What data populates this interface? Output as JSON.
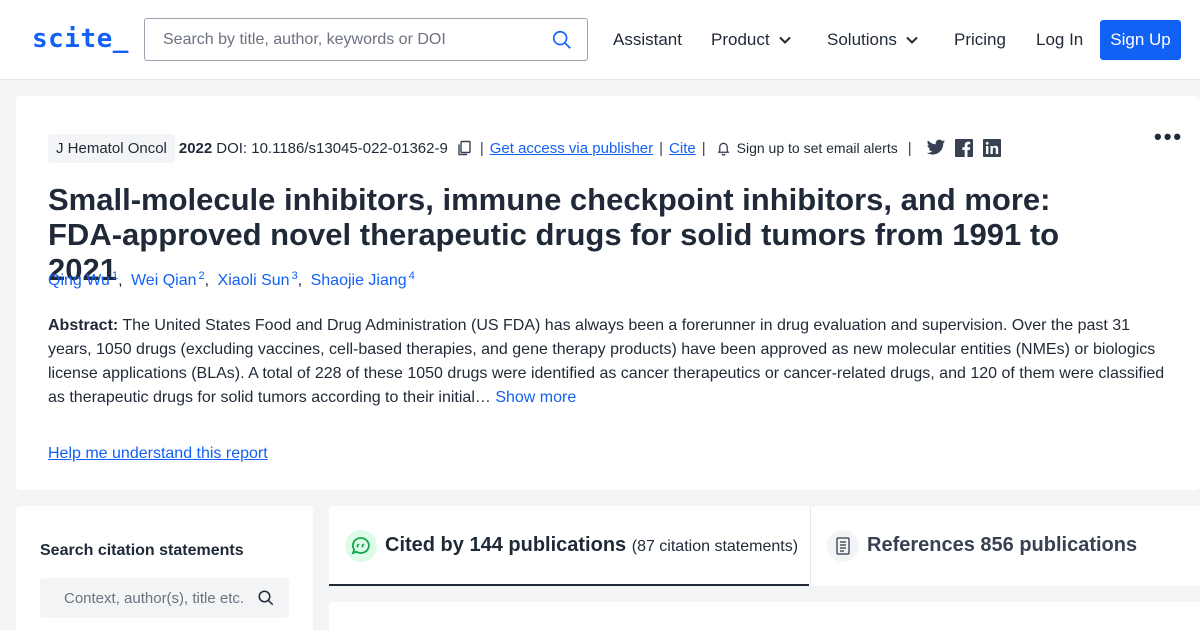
{
  "header": {
    "logo": "scite_",
    "search_placeholder": "Search by title, author, keywords or DOI",
    "nav": {
      "assistant": "Assistant",
      "product": "Product",
      "solutions": "Solutions",
      "pricing": "Pricing",
      "login": "Log In",
      "signup": "Sign Up"
    }
  },
  "paper": {
    "journal": "J Hematol Oncol",
    "year": "2022",
    "doi": "DOI: 10.1186/s13045-022-01362-9",
    "get_access": "Get access via publisher",
    "cite": "Cite",
    "alerts": "Sign up to set email alerts",
    "more_menu": "•••",
    "title": "Small-molecule inhibitors, immune checkpoint inhibitors, and more: FDA-approved novel therapeutic drugs for solid tumors from 1991 to 2021",
    "authors": [
      {
        "name": "Qing Wu",
        "sup": "1"
      },
      {
        "name": "Wei Qian",
        "sup": "2"
      },
      {
        "name": "Xiaoli Sun",
        "sup": "3"
      },
      {
        "name": "Shaojie Jiang",
        "sup": "4"
      }
    ],
    "abstract_label": "Abstract:",
    "abstract_text": " The United States Food and Drug Administration (US FDA) has always been a forerunner in drug evaluation and supervision. Over the past 31 years, 1050 drugs (excluding vaccines, cell-based therapies, and gene therapy products) have been approved as new molecular entities (NMEs) or biologics license applications (BLAs). A total of 228 of these 1050 drugs were identified as cancer therapeutics or cancer-related drugs, and 120 of them were classified as therapeutic drugs for solid tumors according to their initial…",
    "show_more": "Show more",
    "help_link": "Help me understand this report"
  },
  "citation_search": {
    "title": "Search citation statements",
    "placeholder": "Context, author(s), title etc."
  },
  "tabs": {
    "cited_main": "Cited by 144 publications",
    "cited_sub": "(87 citation statements)",
    "references": "References 856 publications"
  },
  "colors": {
    "accent": "#1261f5",
    "cited_icon_bg": "#dcfce7",
    "cited_icon_fg": "#16a34a"
  }
}
